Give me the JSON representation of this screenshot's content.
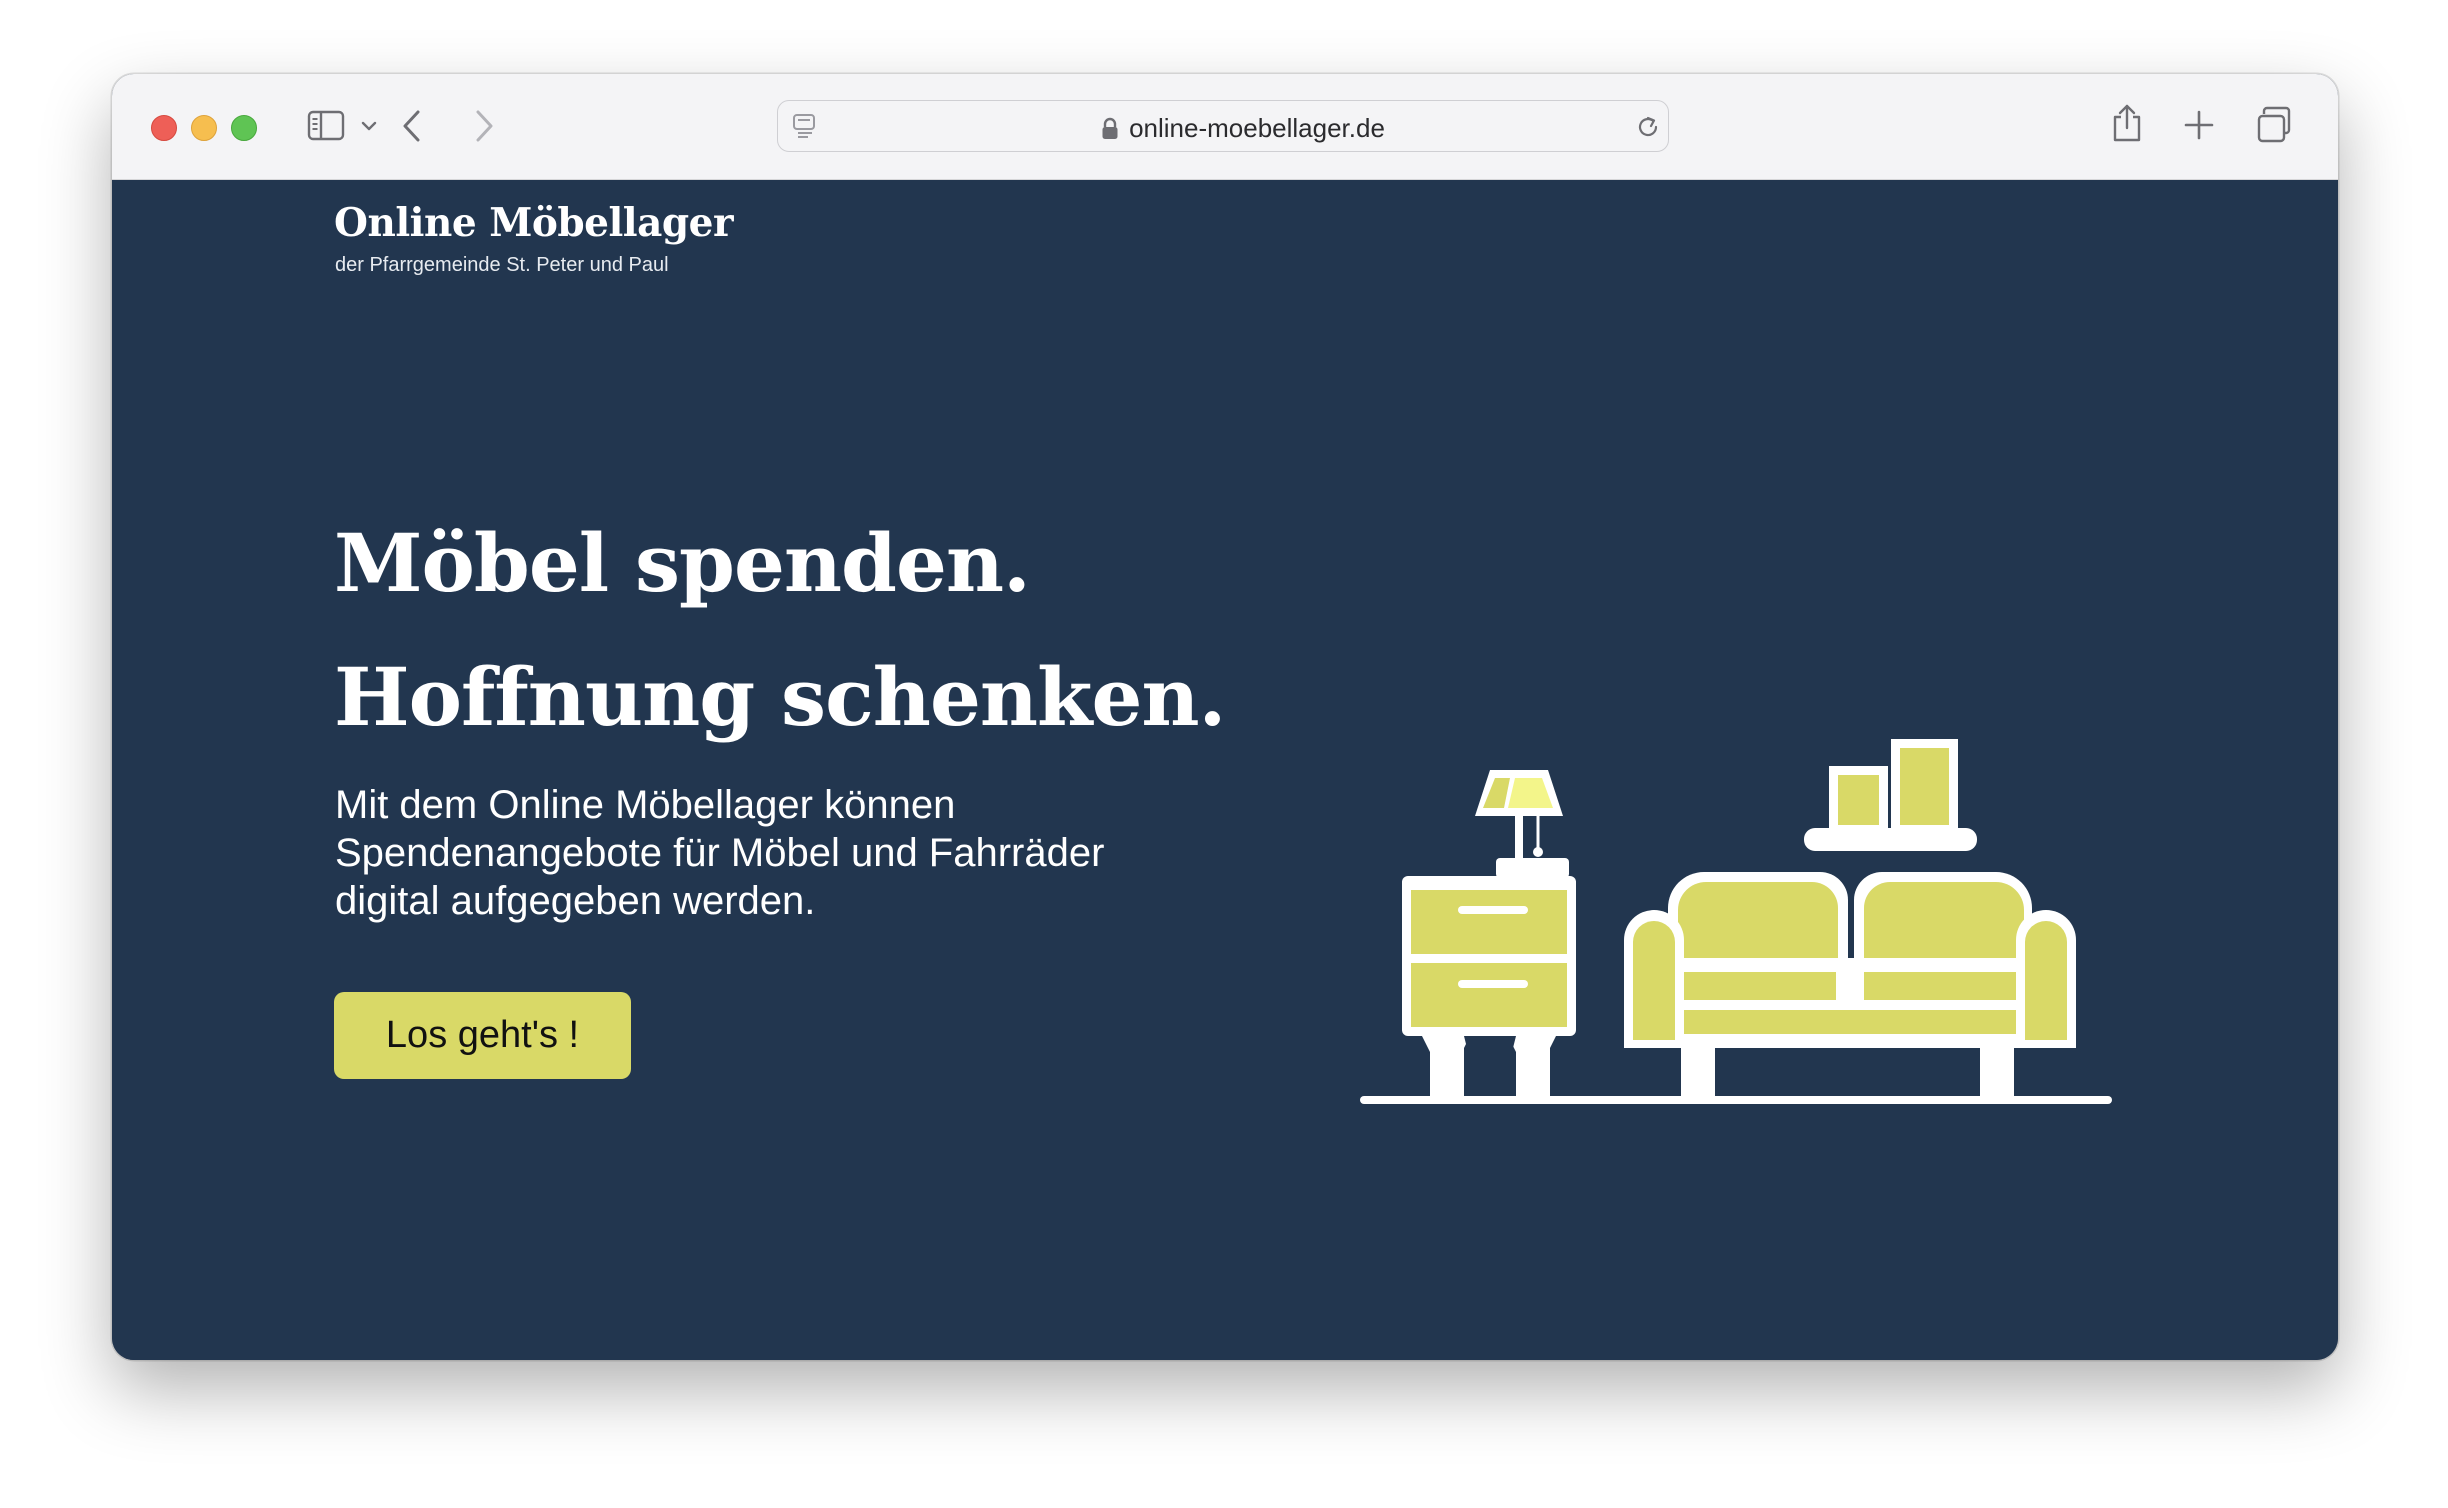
{
  "browser": {
    "url": "online-moebellager.de"
  },
  "site": {
    "title": "Online Möbellager",
    "subtitle": "der Pfarrgemeinde St. Peter und Paul"
  },
  "hero": {
    "headline_1": "Möbel spenden.",
    "headline_2": "Hoffnung schenken.",
    "lead_1": "Mit dem Online Möbellager können",
    "lead_2": "Spendenangebote für Möbel und Fahrräder",
    "lead_3": "digital aufgegeben werden.",
    "cta_label": "Los geht's !"
  },
  "colors": {
    "background": "#22364f",
    "accent": "#d9d967",
    "lamp_highlight": "#f3f58a",
    "toolbar": "#f4f4f6"
  },
  "icons": [
    "sidebar-toggle-icon",
    "chevron-down-icon",
    "back-arrow-icon",
    "forward-arrow-icon",
    "reader-icon",
    "lock-icon",
    "reload-icon",
    "share-icon",
    "new-tab-icon",
    "tab-overview-icon"
  ]
}
